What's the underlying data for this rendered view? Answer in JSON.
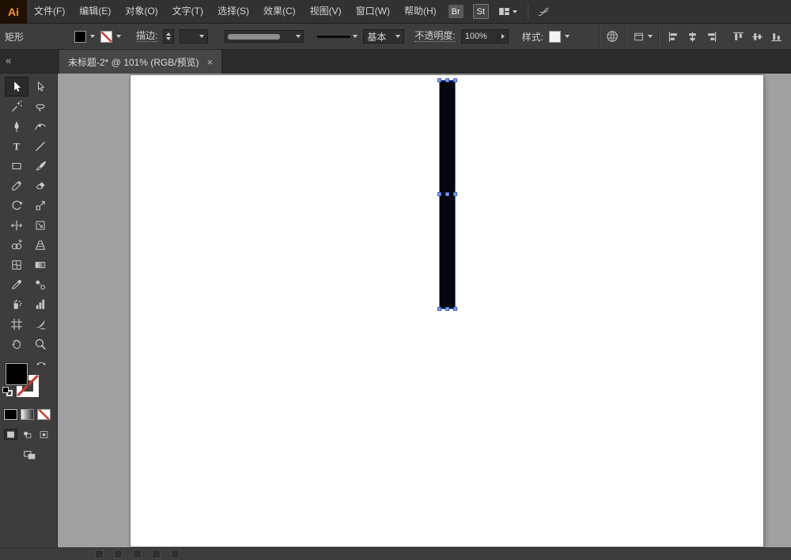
{
  "menubar": {
    "logo": "Ai",
    "items": [
      "文件(F)",
      "编辑(E)",
      "对象(O)",
      "文字(T)",
      "选择(S)",
      "效果(C)",
      "视图(V)",
      "窗口(W)",
      "帮助(H)"
    ],
    "bridge_label": "Br",
    "stock_label": "St"
  },
  "controlbar": {
    "shape_label": "矩形",
    "stroke_label": "描边:",
    "brush_name": "基本",
    "opacity_label": "不透明度:",
    "opacity_value": "100%",
    "style_label": "样式:",
    "align_tools": [
      "horizontal-align-left",
      "horizontal-align-center",
      "horizontal-align-right",
      "vertical-align-top",
      "vertical-align-center",
      "vertical-align-bottom"
    ]
  },
  "tabbar": {
    "collapse_glyph": "«",
    "title": "未标题-2* @ 101% (RGB/预览)",
    "close_glyph": "×"
  },
  "toolbar": {
    "active_tool": "selection",
    "tools": [
      "selection",
      "direct-selection",
      "magic-wand",
      "lasso",
      "pen",
      "curvature",
      "type",
      "line-segment",
      "rectangle",
      "paintbrush",
      "pencil",
      "eraser",
      "rotate",
      "scale",
      "width",
      "free-transform",
      "shape-builder",
      "perspective-grid",
      "mesh",
      "gradient",
      "eyedropper",
      "blend",
      "symbol-sprayer",
      "column-graph",
      "artboard",
      "slice",
      "hand",
      "zoom"
    ]
  },
  "type_tool_glyph": "T",
  "colors": {
    "selection_accent": "#4f7ce8",
    "object_fill": "#06060e",
    "none_slash": "#d43c2a",
    "artboard_bg": "#ffffff"
  }
}
